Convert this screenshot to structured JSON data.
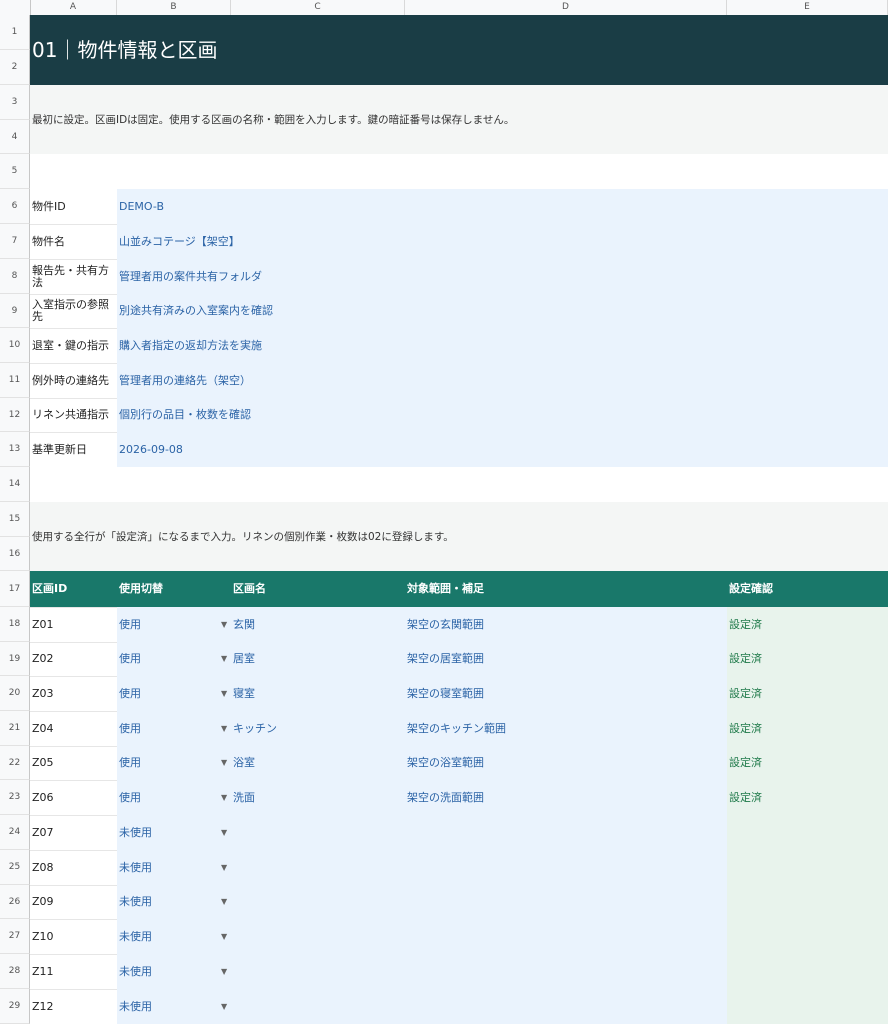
{
  "columns": [
    "A",
    "B",
    "C",
    "D",
    "E"
  ],
  "rows": [
    "1",
    "2",
    "3",
    "4",
    "5",
    "6",
    "7",
    "8",
    "9",
    "10",
    "11",
    "12",
    "13",
    "14",
    "15",
    "16",
    "17",
    "18",
    "19",
    "20",
    "21",
    "22",
    "23",
    "24",
    "25",
    "26",
    "27",
    "28",
    "29"
  ],
  "title": "01｜物件情報と区画",
  "note1": "最初に設定。区画IDは固定。使用する区画の名称・範囲を入力します。鍵の暗証番号は保存しません。",
  "property": [
    {
      "label": "物件ID",
      "value": "DEMO-B"
    },
    {
      "label": "物件名",
      "value": "山並みコテージ【架空】"
    },
    {
      "label": "報告先・共有方法",
      "value": "管理者用の案件共有フォルダ"
    },
    {
      "label": "入室指示の参照先",
      "value": "別途共有済みの入室案内を確認"
    },
    {
      "label": "退室・鍵の指示",
      "value": "購入者指定の返却方法を実施"
    },
    {
      "label": "例外時の連絡先",
      "value": "管理者用の連絡先（架空）"
    },
    {
      "label": "リネン共通指示",
      "value": "個別行の品目・枚数を確認"
    },
    {
      "label": "基準更新日",
      "value": "2026-09-08"
    }
  ],
  "note2": "使用する全行が「設定済」になるまで入力。リネンの個別作業・枚数は02に登録します。",
  "table": {
    "headers": [
      "区画ID",
      "使用切替",
      "区画名",
      "対象範囲・補足",
      "設定確認"
    ],
    "rows": [
      {
        "id": "Z01",
        "use": "使用",
        "name": "玄関",
        "scope": "架空の玄関範囲",
        "status": "設定済"
      },
      {
        "id": "Z02",
        "use": "使用",
        "name": "居室",
        "scope": "架空の居室範囲",
        "status": "設定済"
      },
      {
        "id": "Z03",
        "use": "使用",
        "name": "寝室",
        "scope": "架空の寝室範囲",
        "status": "設定済"
      },
      {
        "id": "Z04",
        "use": "使用",
        "name": "キッチン",
        "scope": "架空のキッチン範囲",
        "status": "設定済"
      },
      {
        "id": "Z05",
        "use": "使用",
        "name": "浴室",
        "scope": "架空の浴室範囲",
        "status": "設定済"
      },
      {
        "id": "Z06",
        "use": "使用",
        "name": "洗面",
        "scope": "架空の洗面範囲",
        "status": "設定済"
      },
      {
        "id": "Z07",
        "use": "未使用",
        "name": "",
        "scope": "",
        "status": ""
      },
      {
        "id": "Z08",
        "use": "未使用",
        "name": "",
        "scope": "",
        "status": ""
      },
      {
        "id": "Z09",
        "use": "未使用",
        "name": "",
        "scope": "",
        "status": ""
      },
      {
        "id": "Z10",
        "use": "未使用",
        "name": "",
        "scope": "",
        "status": ""
      },
      {
        "id": "Z11",
        "use": "未使用",
        "name": "",
        "scope": "",
        "status": ""
      },
      {
        "id": "Z12",
        "use": "未使用",
        "name": "",
        "scope": "",
        "status": ""
      }
    ]
  },
  "dropdown_glyph": "▼",
  "colors": {
    "title_bg": "#1a3d45",
    "header_bg": "#19786a",
    "input_bg": "#eaf3fd",
    "status_bg": "#e8f3ec",
    "value_text": "#2b63a6",
    "status_text": "#1f7a4a"
  }
}
